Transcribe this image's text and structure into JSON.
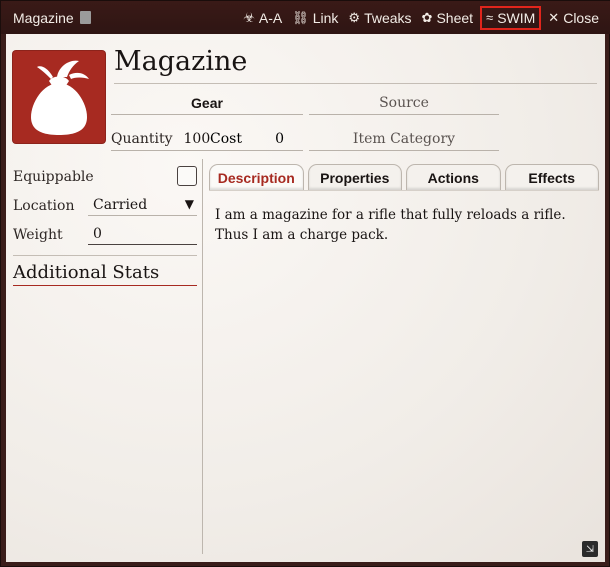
{
  "header": {
    "title": "Magazine",
    "controls": [
      {
        "icon": "biohazard-icon",
        "glyph": "☣",
        "label": "A-A"
      },
      {
        "icon": "link-icon",
        "glyph": "⛓",
        "label": "Link"
      },
      {
        "icon": "tweaks-icon",
        "glyph": "⚙",
        "label": "Tweaks"
      },
      {
        "icon": "sheet-icon",
        "glyph": "✿",
        "label": "Sheet"
      },
      {
        "icon": "swim-icon",
        "glyph": "≈",
        "label": "SWIM"
      },
      {
        "icon": "close-icon",
        "glyph": "✕",
        "label": "Close"
      }
    ]
  },
  "item": {
    "name": "Magazine",
    "type": "Gear",
    "source_placeholder": "Source",
    "quantity_label": "Quantity",
    "quantity": "100",
    "cost_label": "Cost",
    "cost": "0",
    "category_placeholder": "Item Category"
  },
  "left": {
    "equippable_label": "Equippable",
    "location_label": "Location",
    "location_value": "Carried",
    "weight_label": "Weight",
    "weight_value": "0",
    "additional_stats": "Additional Stats"
  },
  "tabs": [
    "Description",
    "Properties",
    "Actions",
    "Effects"
  ],
  "description": "I am a magazine for a rifle that fully reloads a rifle. Thus I am a charge pack.",
  "colors": {
    "accent": "#a72a21",
    "header_bg": "#3a1a17",
    "sheet_bg": "#f1ede8"
  }
}
